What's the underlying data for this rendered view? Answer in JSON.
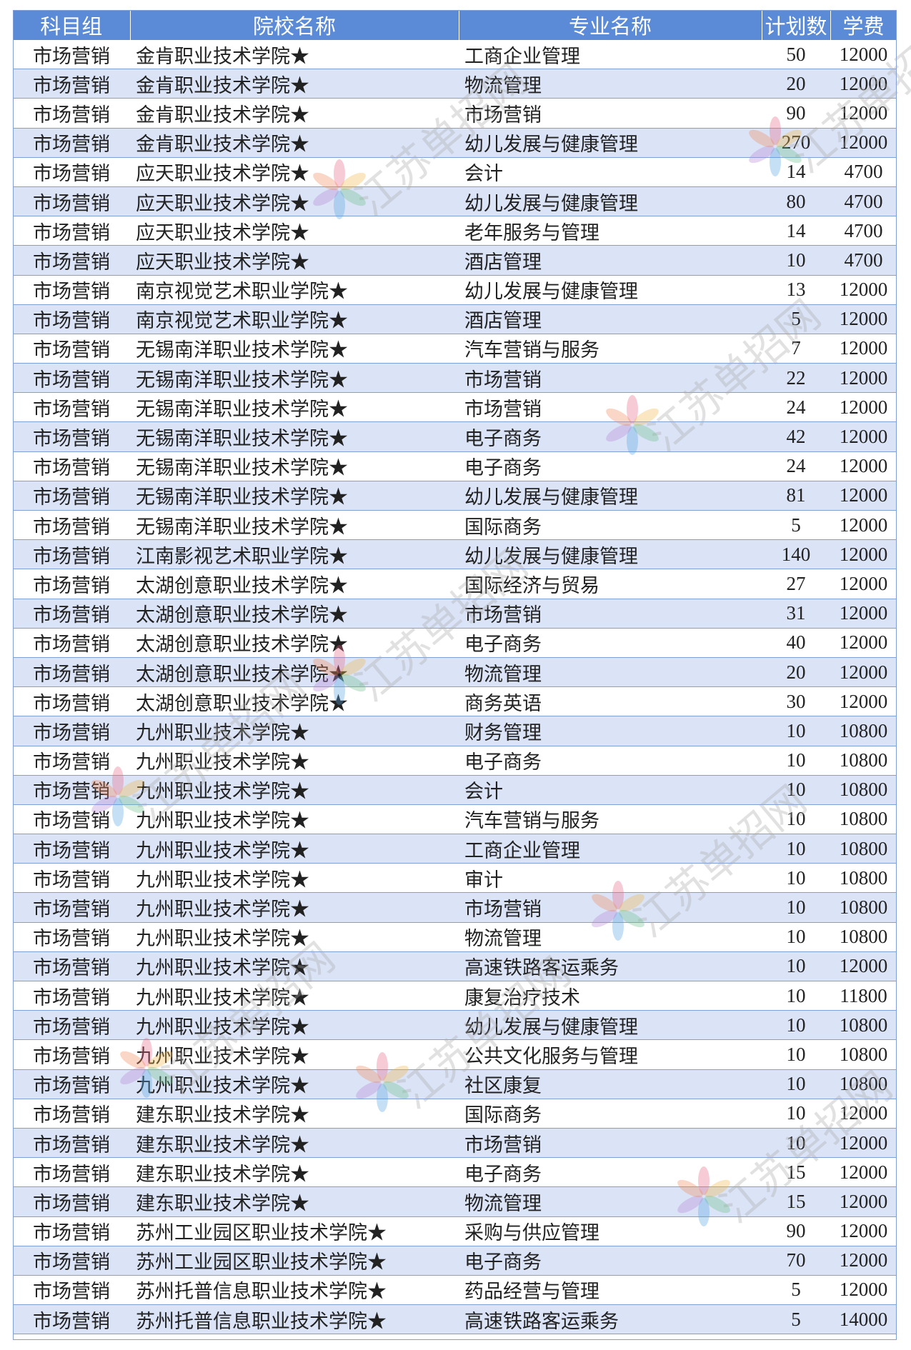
{
  "headers": {
    "group": "科目组",
    "school": "院校名称",
    "major": "专业名称",
    "plan": "计划数",
    "fee": "学费"
  },
  "rows": [
    {
      "group": "市场营销",
      "school": "金肯职业技术学院★",
      "major": "工商企业管理",
      "plan": "50",
      "fee": "12000"
    },
    {
      "group": "市场营销",
      "school": "金肯职业技术学院★",
      "major": "物流管理",
      "plan": "20",
      "fee": "12000"
    },
    {
      "group": "市场营销",
      "school": "金肯职业技术学院★",
      "major": "市场营销",
      "plan": "90",
      "fee": "12000"
    },
    {
      "group": "市场营销",
      "school": "金肯职业技术学院★",
      "major": "幼儿发展与健康管理",
      "plan": "270",
      "fee": "12000"
    },
    {
      "group": "市场营销",
      "school": "应天职业技术学院★",
      "major": "会计",
      "plan": "14",
      "fee": "4700"
    },
    {
      "group": "市场营销",
      "school": "应天职业技术学院★",
      "major": "幼儿发展与健康管理",
      "plan": "80",
      "fee": "4700"
    },
    {
      "group": "市场营销",
      "school": "应天职业技术学院★",
      "major": "老年服务与管理",
      "plan": "14",
      "fee": "4700"
    },
    {
      "group": "市场营销",
      "school": "应天职业技术学院★",
      "major": "酒店管理",
      "plan": "10",
      "fee": "4700"
    },
    {
      "group": "市场营销",
      "school": "南京视觉艺术职业学院★",
      "major": "幼儿发展与健康管理",
      "plan": "13",
      "fee": "12000"
    },
    {
      "group": "市场营销",
      "school": "南京视觉艺术职业学院★",
      "major": "酒店管理",
      "plan": "5",
      "fee": "12000"
    },
    {
      "group": "市场营销",
      "school": "无锡南洋职业技术学院★",
      "major": "汽车营销与服务",
      "plan": "7",
      "fee": "12000"
    },
    {
      "group": "市场营销",
      "school": "无锡南洋职业技术学院★",
      "major": "市场营销",
      "plan": "22",
      "fee": "12000"
    },
    {
      "group": "市场营销",
      "school": "无锡南洋职业技术学院★",
      "major": "市场营销",
      "plan": "24",
      "fee": "12000"
    },
    {
      "group": "市场营销",
      "school": "无锡南洋职业技术学院★",
      "major": "电子商务",
      "plan": "42",
      "fee": "12000"
    },
    {
      "group": "市场营销",
      "school": "无锡南洋职业技术学院★",
      "major": "电子商务",
      "plan": "24",
      "fee": "12000"
    },
    {
      "group": "市场营销",
      "school": "无锡南洋职业技术学院★",
      "major": "幼儿发展与健康管理",
      "plan": "81",
      "fee": "12000"
    },
    {
      "group": "市场营销",
      "school": "无锡南洋职业技术学院★",
      "major": "国际商务",
      "plan": "5",
      "fee": "12000"
    },
    {
      "group": "市场营销",
      "school": "江南影视艺术职业学院★",
      "major": "幼儿发展与健康管理",
      "plan": "140",
      "fee": "12000"
    },
    {
      "group": "市场营销",
      "school": "太湖创意职业技术学院★",
      "major": "国际经济与贸易",
      "plan": "27",
      "fee": "12000"
    },
    {
      "group": "市场营销",
      "school": "太湖创意职业技术学院★",
      "major": "市场营销",
      "plan": "31",
      "fee": "12000"
    },
    {
      "group": "市场营销",
      "school": "太湖创意职业技术学院★",
      "major": "电子商务",
      "plan": "40",
      "fee": "12000"
    },
    {
      "group": "市场营销",
      "school": "太湖创意职业技术学院★",
      "major": "物流管理",
      "plan": "20",
      "fee": "12000"
    },
    {
      "group": "市场营销",
      "school": "太湖创意职业技术学院★",
      "major": "商务英语",
      "plan": "30",
      "fee": "12000"
    },
    {
      "group": "市场营销",
      "school": "九州职业技术学院★",
      "major": "财务管理",
      "plan": "10",
      "fee": "10800"
    },
    {
      "group": "市场营销",
      "school": "九州职业技术学院★",
      "major": "电子商务",
      "plan": "10",
      "fee": "10800"
    },
    {
      "group": "市场营销",
      "school": "九州职业技术学院★",
      "major": "会计",
      "plan": "10",
      "fee": "10800"
    },
    {
      "group": "市场营销",
      "school": "九州职业技术学院★",
      "major": "汽车营销与服务",
      "plan": "10",
      "fee": "10800"
    },
    {
      "group": "市场营销",
      "school": "九州职业技术学院★",
      "major": "工商企业管理",
      "plan": "10",
      "fee": "10800"
    },
    {
      "group": "市场营销",
      "school": "九州职业技术学院★",
      "major": "审计",
      "plan": "10",
      "fee": "10800"
    },
    {
      "group": "市场营销",
      "school": "九州职业技术学院★",
      "major": "市场营销",
      "plan": "10",
      "fee": "10800"
    },
    {
      "group": "市场营销",
      "school": "九州职业技术学院★",
      "major": "物流管理",
      "plan": "10",
      "fee": "10800"
    },
    {
      "group": "市场营销",
      "school": "九州职业技术学院★",
      "major": "高速铁路客运乘务",
      "plan": "10",
      "fee": "12000"
    },
    {
      "group": "市场营销",
      "school": "九州职业技术学院★",
      "major": "康复治疗技术",
      "plan": "10",
      "fee": "11800"
    },
    {
      "group": "市场营销",
      "school": "九州职业技术学院★",
      "major": "幼儿发展与健康管理",
      "plan": "10",
      "fee": "10800"
    },
    {
      "group": "市场营销",
      "school": "九州职业技术学院★",
      "major": "公共文化服务与管理",
      "plan": "10",
      "fee": "10800"
    },
    {
      "group": "市场营销",
      "school": "九州职业技术学院★",
      "major": "社区康复",
      "plan": "10",
      "fee": "10800"
    },
    {
      "group": "市场营销",
      "school": "建东职业技术学院★",
      "major": "国际商务",
      "plan": "10",
      "fee": "12000"
    },
    {
      "group": "市场营销",
      "school": "建东职业技术学院★",
      "major": "市场营销",
      "plan": "10",
      "fee": "12000"
    },
    {
      "group": "市场营销",
      "school": "建东职业技术学院★",
      "major": "电子商务",
      "plan": "15",
      "fee": "12000"
    },
    {
      "group": "市场营销",
      "school": "建东职业技术学院★",
      "major": "物流管理",
      "plan": "15",
      "fee": "12000"
    },
    {
      "group": "市场营销",
      "school": "苏州工业园区职业技术学院★",
      "major": "采购与供应管理",
      "plan": "90",
      "fee": "12000"
    },
    {
      "group": "市场营销",
      "school": "苏州工业园区职业技术学院★",
      "major": "电子商务",
      "plan": "70",
      "fee": "12000"
    },
    {
      "group": "市场营销",
      "school": "苏州托普信息职业技术学院★",
      "major": "药品经营与管理",
      "plan": "5",
      "fee": "12000"
    },
    {
      "group": "市场营销",
      "school": "苏州托普信息职业技术学院★",
      "major": "高速铁路客运乘务",
      "plan": "5",
      "fee": "14000"
    }
  ],
  "watermark": {
    "text": "江苏单招网",
    "icon": "flower-logo-icon"
  }
}
